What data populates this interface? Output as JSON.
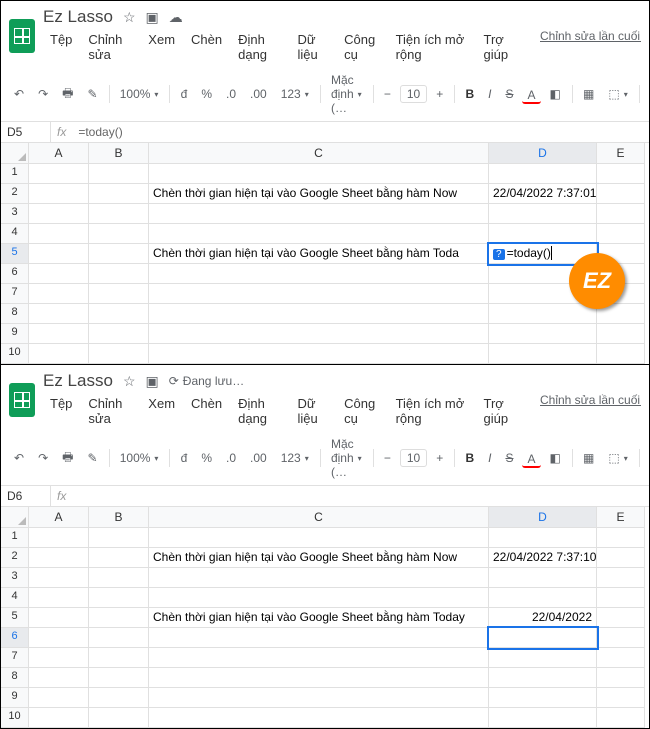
{
  "top": {
    "doc_title": "Ez Lasso",
    "menu": [
      "Tệp",
      "Chỉnh sửa",
      "Xem",
      "Chèn",
      "Định dạng",
      "Dữ liệu",
      "Công cụ",
      "Tiện ích mở rộng",
      "Trợ giúp"
    ],
    "last_edit": "Chỉnh sửa lần cuối vài giâ",
    "toolbar": {
      "zoom": "100%",
      "money": "đ",
      "pct": "%",
      "dec0": ".0",
      "dec00": ".00",
      "num123": "123",
      "font": "Mặc định (…",
      "size": "10",
      "bold": "B",
      "italic": "I",
      "strike": "S",
      "textcolor": "A"
    },
    "namebox": "D5",
    "formula": "=today()",
    "cols": [
      "A",
      "B",
      "C",
      "D",
      "E"
    ],
    "rows": [
      1,
      2,
      3,
      4,
      5,
      6,
      7,
      8,
      9,
      10
    ],
    "cells": {
      "C2": "Chèn thời gian hiện tại vào Google Sheet bằng hàm Now",
      "D2": "22/04/2022 7:37:01",
      "C5": "Chèn thời gian hiện tại vào Google Sheet bằng hàm Toda",
      "D5_hint": "?",
      "D5": "=today()"
    },
    "active_col": "D",
    "active_row": 5
  },
  "bottom": {
    "doc_title": "Ez Lasso",
    "saving": "Đang lưu…",
    "menu": [
      "Tệp",
      "Chỉnh sửa",
      "Xem",
      "Chèn",
      "Định dạng",
      "Dữ liệu",
      "Công cụ",
      "Tiện ích mở rộng",
      "Trợ giúp"
    ],
    "last_edit": "Chỉnh sửa lần cuối vài giâ",
    "toolbar": {
      "zoom": "100%",
      "money": "đ",
      "pct": "%",
      "dec0": ".0",
      "dec00": ".00",
      "num123": "123",
      "font": "Mặc định (…",
      "size": "10",
      "bold": "B",
      "italic": "I",
      "strike": "S",
      "textcolor": "A"
    },
    "namebox": "D6",
    "formula": "",
    "cols": [
      "A",
      "B",
      "C",
      "D",
      "E"
    ],
    "rows": [
      1,
      2,
      3,
      4,
      5,
      6,
      7,
      8,
      9,
      10
    ],
    "cells": {
      "C2": "Chèn thời gian hiện tại vào Google Sheet bằng hàm Now",
      "D2": "22/04/2022 7:37:10",
      "C5": "Chèn thời gian hiện tại vào Google Sheet bằng hàm Today",
      "D5": "22/04/2022"
    },
    "active_col": "D",
    "active_row": 6
  },
  "ez_badge": "EZ"
}
